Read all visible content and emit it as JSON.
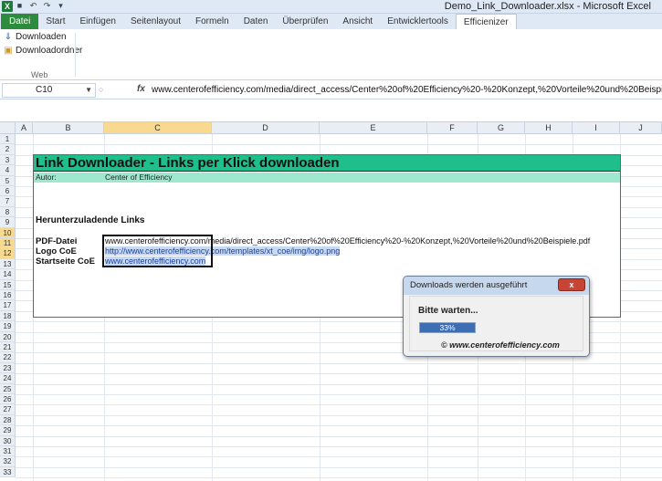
{
  "window": {
    "title": "Demo_Link_Downloader.xlsx - Microsoft Excel",
    "app_icon": "excel-icon",
    "qat": [
      "save-icon",
      "undo-icon",
      "redo-icon",
      "customize-icon"
    ]
  },
  "tabs": [
    {
      "label": "Datei"
    },
    {
      "label": "Start"
    },
    {
      "label": "Einfügen"
    },
    {
      "label": "Seitenlayout"
    },
    {
      "label": "Formeln"
    },
    {
      "label": "Daten"
    },
    {
      "label": "Überprüfen"
    },
    {
      "label": "Ansicht"
    },
    {
      "label": "Entwicklertools"
    },
    {
      "label": "Efficienizer"
    }
  ],
  "ribbon": {
    "downloaden_label": "Downloaden",
    "downloadordner_label": "Downloadordner",
    "group_label": "Web"
  },
  "formula_bar": {
    "name_box": "C10",
    "fx_label": "fx",
    "formula": "www.centerofefficiency.com/media/direct_access/Center%20of%20Efficiency%20-%20Konzept,%20Vorteile%20und%20Beispiele.pdf"
  },
  "columns": [
    "A",
    "B",
    "C",
    "D",
    "E",
    "F",
    "G",
    "H",
    "I",
    "J"
  ],
  "rows": [
    "1",
    "2",
    "3",
    "4",
    "5",
    "6",
    "7",
    "8",
    "9",
    "10",
    "11",
    "12",
    "13",
    "14",
    "15",
    "16",
    "17",
    "18",
    "19",
    "20",
    "21",
    "22",
    "23",
    "24",
    "25",
    "26",
    "27",
    "28",
    "29",
    "30",
    "31",
    "32",
    "33"
  ],
  "sheet": {
    "banner_title": "Link Downloader - Links per Klick downloaden",
    "author_label": "Autor:",
    "author_value": "Center of Efficiency",
    "section_heading": "Herunterzuladende Links",
    "links": [
      {
        "label": "PDF-Datei",
        "url": "www.centerofefficiency.com/media/direct_access/Center%20of%20Efficiency%20-%20Konzept,%20Vorteile%20und%20Beispiele.pdf"
      },
      {
        "label": "Logo CoE",
        "url": "http://www.centerofefficiency.com/templates/xt_coe/img/logo.png"
      },
      {
        "label": "Startseite CoE",
        "url": "www.centerofefficiency.com"
      }
    ]
  },
  "dialog": {
    "title": "Downloads werden ausgeführt",
    "close_label": "x",
    "wait_text": "Bitte warten...",
    "progress_percent": 33,
    "progress_text": "33%",
    "footer": "© www.centerofefficiency.com"
  },
  "colors": {
    "banner": "#1fbf8c",
    "author_band": "#9ee8cf",
    "file_tab": "#2d8b3d",
    "progress": "#3c6db5"
  }
}
